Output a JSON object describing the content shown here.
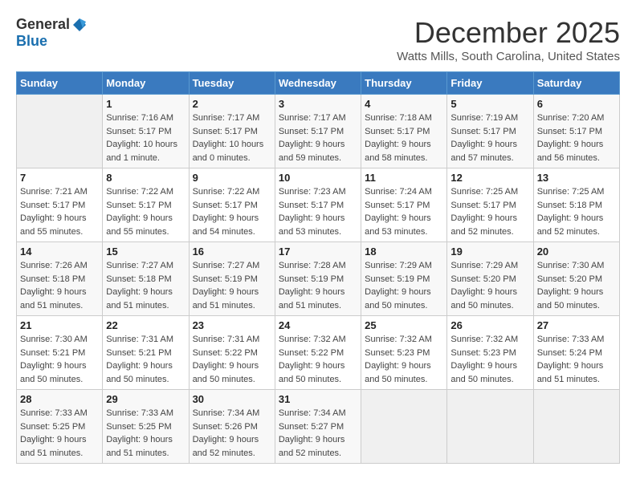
{
  "logo": {
    "general": "General",
    "blue": "Blue"
  },
  "title": "December 2025",
  "subtitle": "Watts Mills, South Carolina, United States",
  "days_of_week": [
    "Sunday",
    "Monday",
    "Tuesday",
    "Wednesday",
    "Thursday",
    "Friday",
    "Saturday"
  ],
  "weeks": [
    [
      {
        "day": "",
        "info": ""
      },
      {
        "day": "1",
        "info": "Sunrise: 7:16 AM\nSunset: 5:17 PM\nDaylight: 10 hours\nand 1 minute."
      },
      {
        "day": "2",
        "info": "Sunrise: 7:17 AM\nSunset: 5:17 PM\nDaylight: 10 hours\nand 0 minutes."
      },
      {
        "day": "3",
        "info": "Sunrise: 7:17 AM\nSunset: 5:17 PM\nDaylight: 9 hours\nand 59 minutes."
      },
      {
        "day": "4",
        "info": "Sunrise: 7:18 AM\nSunset: 5:17 PM\nDaylight: 9 hours\nand 58 minutes."
      },
      {
        "day": "5",
        "info": "Sunrise: 7:19 AM\nSunset: 5:17 PM\nDaylight: 9 hours\nand 57 minutes."
      },
      {
        "day": "6",
        "info": "Sunrise: 7:20 AM\nSunset: 5:17 PM\nDaylight: 9 hours\nand 56 minutes."
      }
    ],
    [
      {
        "day": "7",
        "info": "Sunrise: 7:21 AM\nSunset: 5:17 PM\nDaylight: 9 hours\nand 55 minutes."
      },
      {
        "day": "8",
        "info": "Sunrise: 7:22 AM\nSunset: 5:17 PM\nDaylight: 9 hours\nand 55 minutes."
      },
      {
        "day": "9",
        "info": "Sunrise: 7:22 AM\nSunset: 5:17 PM\nDaylight: 9 hours\nand 54 minutes."
      },
      {
        "day": "10",
        "info": "Sunrise: 7:23 AM\nSunset: 5:17 PM\nDaylight: 9 hours\nand 53 minutes."
      },
      {
        "day": "11",
        "info": "Sunrise: 7:24 AM\nSunset: 5:17 PM\nDaylight: 9 hours\nand 53 minutes."
      },
      {
        "day": "12",
        "info": "Sunrise: 7:25 AM\nSunset: 5:17 PM\nDaylight: 9 hours\nand 52 minutes."
      },
      {
        "day": "13",
        "info": "Sunrise: 7:25 AM\nSunset: 5:18 PM\nDaylight: 9 hours\nand 52 minutes."
      }
    ],
    [
      {
        "day": "14",
        "info": "Sunrise: 7:26 AM\nSunset: 5:18 PM\nDaylight: 9 hours\nand 51 minutes."
      },
      {
        "day": "15",
        "info": "Sunrise: 7:27 AM\nSunset: 5:18 PM\nDaylight: 9 hours\nand 51 minutes."
      },
      {
        "day": "16",
        "info": "Sunrise: 7:27 AM\nSunset: 5:19 PM\nDaylight: 9 hours\nand 51 minutes."
      },
      {
        "day": "17",
        "info": "Sunrise: 7:28 AM\nSunset: 5:19 PM\nDaylight: 9 hours\nand 51 minutes."
      },
      {
        "day": "18",
        "info": "Sunrise: 7:29 AM\nSunset: 5:19 PM\nDaylight: 9 hours\nand 50 minutes."
      },
      {
        "day": "19",
        "info": "Sunrise: 7:29 AM\nSunset: 5:20 PM\nDaylight: 9 hours\nand 50 minutes."
      },
      {
        "day": "20",
        "info": "Sunrise: 7:30 AM\nSunset: 5:20 PM\nDaylight: 9 hours\nand 50 minutes."
      }
    ],
    [
      {
        "day": "21",
        "info": "Sunrise: 7:30 AM\nSunset: 5:21 PM\nDaylight: 9 hours\nand 50 minutes."
      },
      {
        "day": "22",
        "info": "Sunrise: 7:31 AM\nSunset: 5:21 PM\nDaylight: 9 hours\nand 50 minutes."
      },
      {
        "day": "23",
        "info": "Sunrise: 7:31 AM\nSunset: 5:22 PM\nDaylight: 9 hours\nand 50 minutes."
      },
      {
        "day": "24",
        "info": "Sunrise: 7:32 AM\nSunset: 5:22 PM\nDaylight: 9 hours\nand 50 minutes."
      },
      {
        "day": "25",
        "info": "Sunrise: 7:32 AM\nSunset: 5:23 PM\nDaylight: 9 hours\nand 50 minutes."
      },
      {
        "day": "26",
        "info": "Sunrise: 7:32 AM\nSunset: 5:23 PM\nDaylight: 9 hours\nand 50 minutes."
      },
      {
        "day": "27",
        "info": "Sunrise: 7:33 AM\nSunset: 5:24 PM\nDaylight: 9 hours\nand 51 minutes."
      }
    ],
    [
      {
        "day": "28",
        "info": "Sunrise: 7:33 AM\nSunset: 5:25 PM\nDaylight: 9 hours\nand 51 minutes."
      },
      {
        "day": "29",
        "info": "Sunrise: 7:33 AM\nSunset: 5:25 PM\nDaylight: 9 hours\nand 51 minutes."
      },
      {
        "day": "30",
        "info": "Sunrise: 7:34 AM\nSunset: 5:26 PM\nDaylight: 9 hours\nand 52 minutes."
      },
      {
        "day": "31",
        "info": "Sunrise: 7:34 AM\nSunset: 5:27 PM\nDaylight: 9 hours\nand 52 minutes."
      },
      {
        "day": "",
        "info": ""
      },
      {
        "day": "",
        "info": ""
      },
      {
        "day": "",
        "info": ""
      }
    ]
  ]
}
